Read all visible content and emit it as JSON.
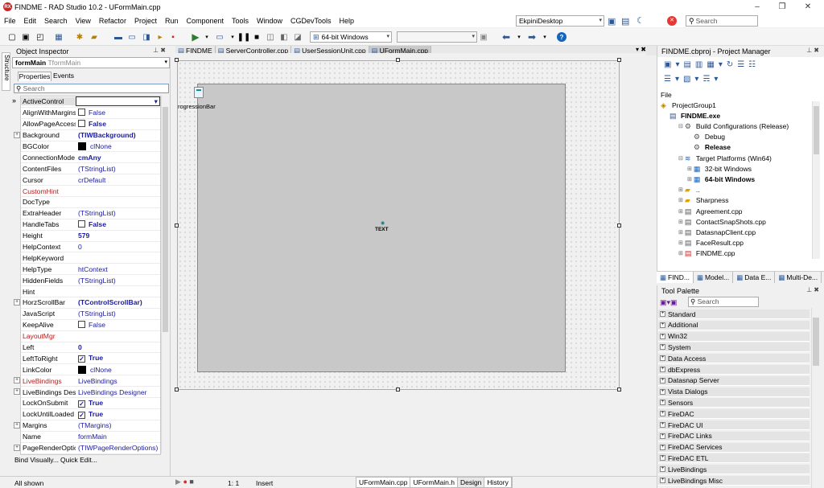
{
  "window": {
    "title": "FINDME - RAD Studio 10.2 - UFormMain.cpp",
    "app_icon": "RX",
    "minimize": "–",
    "maximize": "❐",
    "close": "✕"
  },
  "menu": [
    "File",
    "Edit",
    "Search",
    "View",
    "Refactor",
    "Project",
    "Run",
    "Component",
    "Tools",
    "Window",
    "CGDevTools",
    "Help"
  ],
  "layout_combo": "EkpiniDesktop",
  "search_placeholder": "Search",
  "platform_combo": "64-bit Windows",
  "editor_tabs": [
    "FINDME",
    "ServerController.cpp",
    "UserSessionUnit.cpp",
    "UFormMain.cpp"
  ],
  "object_inspector": {
    "title": "Object Inspector",
    "component": "formMain",
    "component_type": "TformMain",
    "tabs": [
      "Properties",
      "Events"
    ],
    "search_placeholder": "Search",
    "side_tab": "Structure",
    "properties": [
      {
        "name": "ActiveControl",
        "value": "",
        "type": "sel"
      },
      {
        "name": "AlignWithMargins",
        "value": "False",
        "check": "off"
      },
      {
        "name": "AllowPageAccess",
        "value": "False",
        "check": "off",
        "bold": true
      },
      {
        "name": "Background",
        "value": "(TIWBackground)",
        "bold": true,
        "exp": true
      },
      {
        "name": "BGColor",
        "value": "clNone",
        "swatch": true
      },
      {
        "name": "ConnectionMode",
        "value": "cmAny",
        "bold": true
      },
      {
        "name": "ContentFiles",
        "value": "(TStringList)"
      },
      {
        "name": "Cursor",
        "value": "crDefault"
      },
      {
        "name": "CustomHint",
        "value": "",
        "red": true
      },
      {
        "name": "DocType",
        "value": ""
      },
      {
        "name": "ExtraHeader",
        "value": "(TStringList)"
      },
      {
        "name": "HandleTabs",
        "value": "False",
        "check": "off",
        "bold": true
      },
      {
        "name": "Height",
        "value": "579",
        "bold": true
      },
      {
        "name": "HelpContext",
        "value": "0"
      },
      {
        "name": "HelpKeyword",
        "value": ""
      },
      {
        "name": "HelpType",
        "value": "htContext"
      },
      {
        "name": "HiddenFields",
        "value": "(TStringList)"
      },
      {
        "name": "Hint",
        "value": ""
      },
      {
        "name": "HorzScrollBar",
        "value": "(TControlScrollBar)",
        "bold": true,
        "exp": true
      },
      {
        "name": "JavaScript",
        "value": "(TStringList)"
      },
      {
        "name": "KeepAlive",
        "value": "False",
        "check": "off"
      },
      {
        "name": "LayoutMgr",
        "value": "",
        "red": true
      },
      {
        "name": "Left",
        "value": "0",
        "bold": true
      },
      {
        "name": "LeftToRight",
        "value": "True",
        "check": "on",
        "bold": true
      },
      {
        "name": "LinkColor",
        "value": "clNone",
        "swatch": true
      },
      {
        "name": "LiveBindings",
        "value": "LiveBindings",
        "red": true,
        "exp": true
      },
      {
        "name": "LiveBindings Desig",
        "value": "LiveBindings Designer",
        "exp": true
      },
      {
        "name": "LockOnSubmit",
        "value": "True",
        "check": "on",
        "bold": true
      },
      {
        "name": "LockUntilLoaded",
        "value": "True",
        "check": "on",
        "bold": true
      },
      {
        "name": "Margins",
        "value": "(TMargins)",
        "exp": true
      },
      {
        "name": "Name",
        "value": "formMain"
      },
      {
        "name": "PageRenderOptio",
        "value": "(TIWPageRenderOptions)",
        "exp": true
      }
    ],
    "bind_visually": "Bind Visually...",
    "quick_edit": "Quick Edit...",
    "status": "All shown"
  },
  "designer": {
    "progress_label": "rogressionBar",
    "text_label": "TEXT"
  },
  "project_manager": {
    "title": "FINDME.cbproj - Project Manager",
    "file_label": "File",
    "tree": [
      {
        "label": "ProjectGroup1",
        "indent": 0,
        "bold": false
      },
      {
        "label": "FINDME.exe",
        "indent": 1,
        "bold": true
      },
      {
        "label": "Build Configurations (Release)",
        "indent": 2,
        "bold": false
      },
      {
        "label": "Debug",
        "indent": 3,
        "bold": false
      },
      {
        "label": "Release",
        "indent": 3,
        "bold": true
      },
      {
        "label": "Target Platforms (Win64)",
        "indent": 2,
        "bold": false
      },
      {
        "label": "32-bit Windows",
        "indent": 3,
        "bold": false
      },
      {
        "label": "64-bit Windows",
        "indent": 3,
        "bold": true
      },
      {
        "label": "..",
        "indent": 2,
        "bold": false
      },
      {
        "label": "Sharpness",
        "indent": 2,
        "bold": false
      },
      {
        "label": "Agreement.cpp",
        "indent": 2,
        "bold": false
      },
      {
        "label": "ContactSnapShots.cpp",
        "indent": 2,
        "bold": false
      },
      {
        "label": "DatasnapClient.cpp",
        "indent": 2,
        "bold": false
      },
      {
        "label": "FaceResult.cpp",
        "indent": 2,
        "bold": false
      },
      {
        "label": "FINDME.cpp",
        "indent": 2,
        "bold": false
      }
    ],
    "bottom_tabs": [
      "FIND...",
      "Model...",
      "Data E...",
      "Multi-De..."
    ]
  },
  "tool_palette": {
    "title": "Tool Palette",
    "search_placeholder": "Search",
    "categories": [
      "Standard",
      "Additional",
      "Win32",
      "System",
      "Data Access",
      "dbExpress",
      "Datasnap Server",
      "Vista Dialogs",
      "Sensors",
      "FireDAC",
      "FireDAC UI",
      "FireDAC Links",
      "FireDAC Services",
      "FireDAC ETL",
      "LiveBindings",
      "LiveBindings Misc"
    ]
  },
  "status": {
    "position": "1:   1",
    "mode": "Insert",
    "view_tabs": [
      "UFormMain.cpp",
      "UFormMain.h",
      "Design",
      "History"
    ]
  }
}
